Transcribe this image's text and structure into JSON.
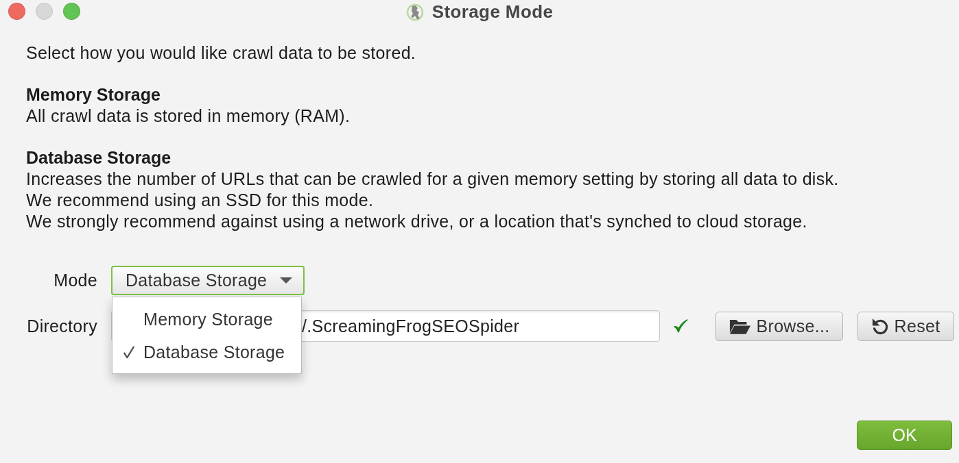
{
  "window": {
    "title": "Storage Mode",
    "buttons": [
      {
        "kind": "close",
        "disabled": false
      },
      {
        "kind": "minimize",
        "disabled": true
      },
      {
        "kind": "zoom",
        "disabled": false
      }
    ]
  },
  "intro": "Select how you would like crawl data to be stored.",
  "sections": [
    {
      "heading": "Memory Storage",
      "lines": [
        "All crawl data is stored in memory (RAM)."
      ]
    },
    {
      "heading": "Database Storage",
      "lines": [
        "Increases the number of URLs that can be crawled for a given memory setting by storing all data to disk.",
        "We recommend using an SSD for this mode.",
        "We strongly recommend against using a network drive, or a location that's synched to cloud storage."
      ]
    }
  ],
  "mode": {
    "label": "Mode",
    "value": "Database Storage",
    "expanded": true,
    "options": [
      {
        "label": "Memory Storage",
        "selected": false
      },
      {
        "label": "Database Storage",
        "selected": true
      }
    ]
  },
  "directory": {
    "label": "Directory",
    "value": "/.ScreamingFrogSEOSpider",
    "valid": true,
    "buttons": [
      {
        "kind": "browse",
        "label": "Browse..."
      },
      {
        "kind": "reset",
        "label": "Reset"
      }
    ]
  },
  "footer": {
    "ok_label": "OK"
  }
}
